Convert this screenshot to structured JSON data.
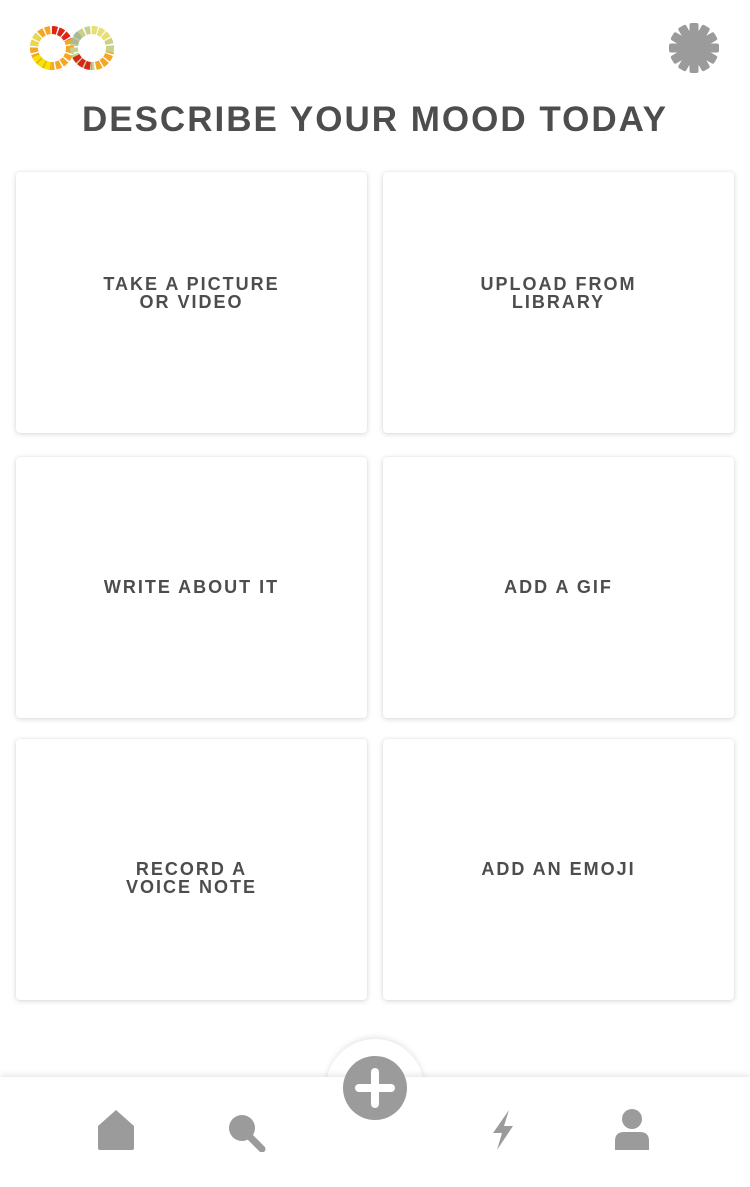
{
  "header": {
    "logo_icon": "infinity-logo-icon",
    "settings_icon": "gear-icon"
  },
  "page_title": "DESCRIBE YOUR MOOD TODAY",
  "options": [
    {
      "line1": "TAKE A PICTURE",
      "line2": "OR VIDEO"
    },
    {
      "line1": "UPLOAD FROM",
      "line2": "LIBRARY"
    },
    {
      "line1": "WRITE ABOUT IT"
    },
    {
      "line1": "ADD A GIF"
    },
    {
      "line1": "RECORD A",
      "line2": "VOICE NOTE"
    },
    {
      "line1": "ADD AN EMOJI"
    }
  ],
  "bottom_nav": {
    "items": [
      "home-icon",
      "search-icon",
      "add-icon",
      "lightning-icon",
      "profile-icon"
    ]
  },
  "colors": {
    "text": "#4d4d4d",
    "icon_gray": "#9b9b9b",
    "logo_red": "#d9261c",
    "logo_orange": "#f5a623",
    "logo_yellow": "#f2e600",
    "logo_green": "#b8c9a0"
  }
}
